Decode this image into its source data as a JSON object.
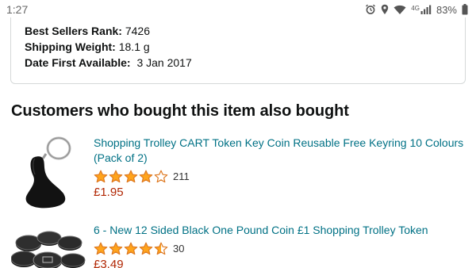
{
  "status_bar": {
    "time": "1:27",
    "network_label": "4G",
    "battery_percent": "83%",
    "icons": [
      "alarm-icon",
      "location-icon",
      "wifi-icon",
      "signal-icon",
      "battery-icon"
    ]
  },
  "details": {
    "rows": [
      {
        "key": "Best Sellers Rank:",
        "value": "7426"
      },
      {
        "key": "Shipping Weight:",
        "value": "18.1 g"
      },
      {
        "key": "Date First Available:",
        "value": "3 Jan 2017"
      }
    ]
  },
  "section": {
    "title": "Customers who bought this item also bought"
  },
  "products": [
    {
      "title": "Shopping Trolley CART Token Key Coin Reusable Free Keyring 10 Colours (Pack of 2)",
      "rating": 4,
      "review_count": "211",
      "price": "£1.95",
      "image": "keyring-token-image"
    },
    {
      "title": "6 - New 12 Sided Black One Pound Coin £1 Shopping Trolley Token",
      "rating": 4.5,
      "review_count": "30",
      "price": "£3.49",
      "image": "black-coins-image"
    }
  ],
  "colors": {
    "link": "#007185",
    "price": "#b12704",
    "star": "#ffa41c",
    "star_outline": "#de7921"
  }
}
